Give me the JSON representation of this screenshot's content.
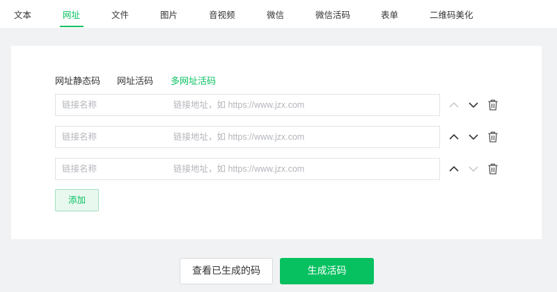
{
  "nav": {
    "tabs": [
      {
        "label": "文本"
      },
      {
        "label": "网址",
        "active": true
      },
      {
        "label": "文件"
      },
      {
        "label": "图片"
      },
      {
        "label": "音视频"
      },
      {
        "label": "微信"
      },
      {
        "label": "微信活码"
      },
      {
        "label": "表单"
      },
      {
        "label": "二维码美化"
      }
    ]
  },
  "subtabs": [
    {
      "label": "网址静态码"
    },
    {
      "label": "网址活码"
    },
    {
      "label": "多网址活码",
      "active": true
    }
  ],
  "link_rows": [
    {
      "name_placeholder": "链接名称",
      "url_placeholder": "链接地址，如 https://www.jzx.com",
      "up_enabled": false,
      "down_enabled": true
    },
    {
      "name_placeholder": "链接名称",
      "url_placeholder": "链接地址，如 https://www.jzx.com",
      "up_enabled": true,
      "down_enabled": true
    },
    {
      "name_placeholder": "链接名称",
      "url_placeholder": "链接地址，如 https://www.jzx.com",
      "up_enabled": true,
      "down_enabled": false
    }
  ],
  "icons": {
    "up": "chevron-up-icon",
    "down": "chevron-down-icon",
    "delete": "trash-icon"
  },
  "add_label": "添加",
  "actions": {
    "view_label": "查看已生成的码",
    "generate_label": "生成活码"
  },
  "colors": {
    "accent": "#07c160",
    "disabled_icon": "#c8cacd",
    "icon": "#333333"
  }
}
